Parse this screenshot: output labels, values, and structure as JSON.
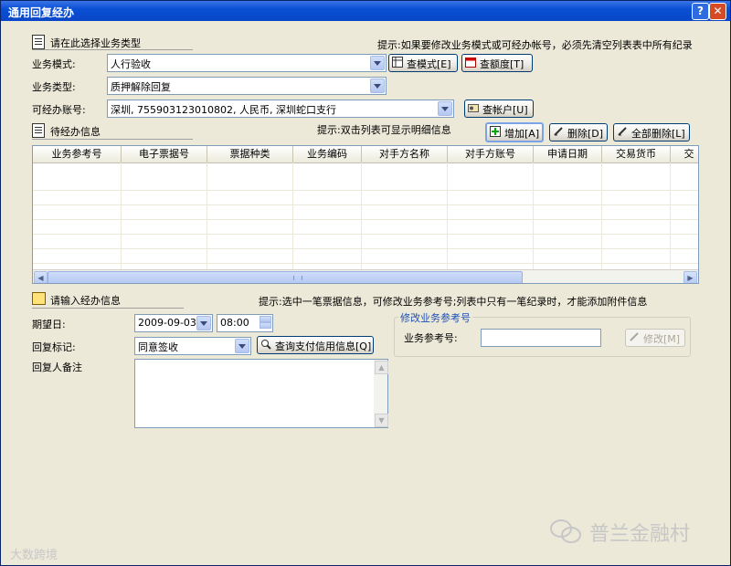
{
  "window": {
    "title": "通用回复经办",
    "help_label": "?",
    "close_label": "✕"
  },
  "section_type": {
    "heading": "请在此选择业务类型",
    "hint": "提示:如果要修改业务模式或可经办帐号，必须先清空列表表中所有纪录",
    "mode_label": "业务模式:",
    "mode_value": "人行验收",
    "type_label": "业务类型:",
    "type_value": "质押解除回复",
    "account_label": "可经办账号:",
    "account_value": "深圳, 755903123010802, 人民币, 深圳蛇口支行",
    "btn_view_mode": "查模式[E]",
    "btn_view_quota": "查额度[T]",
    "btn_view_account": "查帐户[U]"
  },
  "section_pending": {
    "heading": "待经办信息",
    "hint": "提示:双击列表可显示明细信息",
    "btn_add": "增加[A]",
    "btn_delete": "删除[D]",
    "btn_delete_all": "全部删除[L]",
    "columns": [
      "业务参考号",
      "电子票据号",
      "票据种类",
      "业务编码",
      "对手方名称",
      "对手方账号",
      "申请日期",
      "交易货币",
      "交"
    ],
    "rows": []
  },
  "section_input": {
    "heading": "请输入经办信息",
    "hint": "提示:选中一笔票据信息，可修改业务参考号;列表中只有一笔纪录时，才能添加附件信息",
    "date_label": "期望日:",
    "date_value": "2009-09-03",
    "time_value": "08:00",
    "reply_label": "回复标记:",
    "reply_value": "同意签收",
    "btn_query_credit": "查询支付信用信息[Q]",
    "note_label": "回复人备注",
    "note_value": "",
    "group_title": "修改业务参考号",
    "ref_label": "业务参考号:",
    "ref_value": "",
    "btn_modify": "修改[M]"
  },
  "watermarks": {
    "left": "大数跨境",
    "right": "普兰金融村"
  },
  "colors": {
    "titlebar": "#0a46c8",
    "dialog_bg": "#ece9d8",
    "group_title": "#1f4fb5"
  }
}
